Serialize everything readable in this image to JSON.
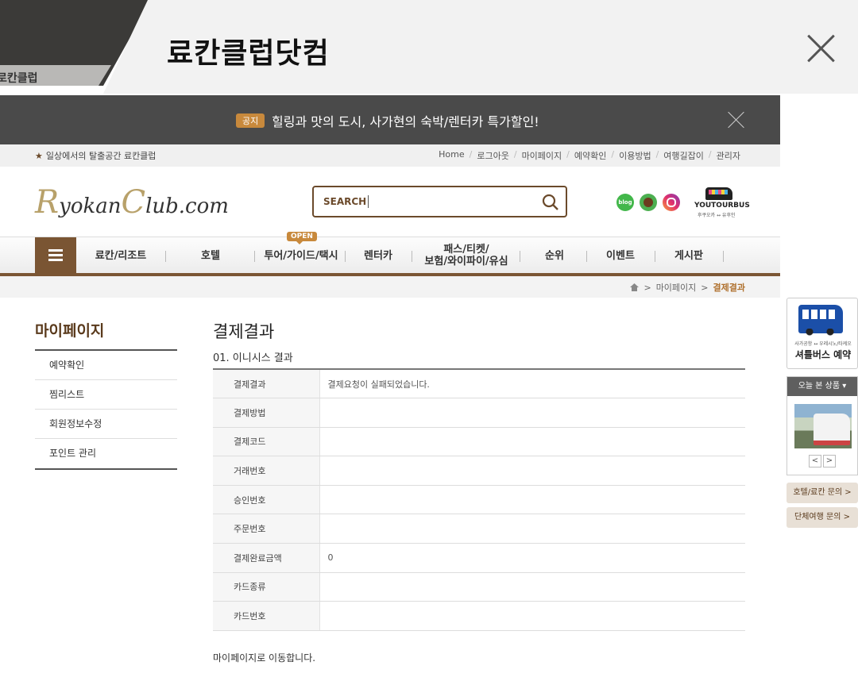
{
  "browser": {
    "inactive_tab_label": "로칸클럽",
    "active_tab_title": "료칸클럽닷컴"
  },
  "notice": {
    "badge": "공지",
    "text": "힐링과 맛의 도시, 사가현의 숙박/렌터카 특가할인!"
  },
  "util": {
    "slogan": "일상에서의 탈출공간 료칸클럽",
    "links": [
      "Home",
      "로그아웃",
      "마이페이지",
      "예약확인",
      "이용방법",
      "여행길잡이",
      "관리자"
    ]
  },
  "header": {
    "logo_r": "R",
    "logo_yokan": "yokan",
    "logo_c": "C",
    "logo_lub": "lub.com",
    "search_label": "SEARCH",
    "sns_blog": "blog",
    "youtourbus_name": "YOUTOURBUS",
    "youtourbus_sub": "후쿠오카 ↔ 유후인"
  },
  "nav": {
    "open_badge": "OPEN",
    "items": [
      "료칸/리조트",
      "호텔",
      "투어/가이드/택시",
      "렌터카",
      "패스/티켓/",
      "보험/와이파이/유심",
      "순위",
      "이벤트",
      "게시판"
    ]
  },
  "breadcrumb": {
    "separator": ">",
    "mypage": "마이페이지",
    "current": "결제결과"
  },
  "sidebar": {
    "title": "마이페이지",
    "items": [
      "예약확인",
      "찜리스트",
      "회원정보수정",
      "포인트 관리"
    ]
  },
  "content": {
    "title": "결제결과",
    "subtitle": "01. 이니시스 결과",
    "rows": [
      {
        "label": "결제결과",
        "value": "결제요청이 실패되었습니다."
      },
      {
        "label": "결제방법",
        "value": ""
      },
      {
        "label": "결제코드",
        "value": ""
      },
      {
        "label": "거래번호",
        "value": ""
      },
      {
        "label": "승인번호",
        "value": ""
      },
      {
        "label": "주문번호",
        "value": ""
      },
      {
        "label": "결제완료금액",
        "value": "0"
      },
      {
        "label": "카드종류",
        "value": ""
      },
      {
        "label": "카드번호",
        "value": ""
      }
    ],
    "footer_message": "마이페이지로 이동합니다."
  },
  "right_panel": {
    "shuttle_sub": "사가공항 ↔ 우레시노/타케오",
    "shuttle_label": "셔틀버스 예약",
    "recent_title": "오늘 본 상품 ▾",
    "prev": "<",
    "next": ">",
    "hotel_inquiry": "호텔/료칸 문의 >",
    "group_inquiry": "단체여행 문의 >"
  },
  "colors": {
    "brand_brown": "#7a5533",
    "accent_orange": "#c8893c",
    "notice_bg": "#4a4a4a"
  }
}
